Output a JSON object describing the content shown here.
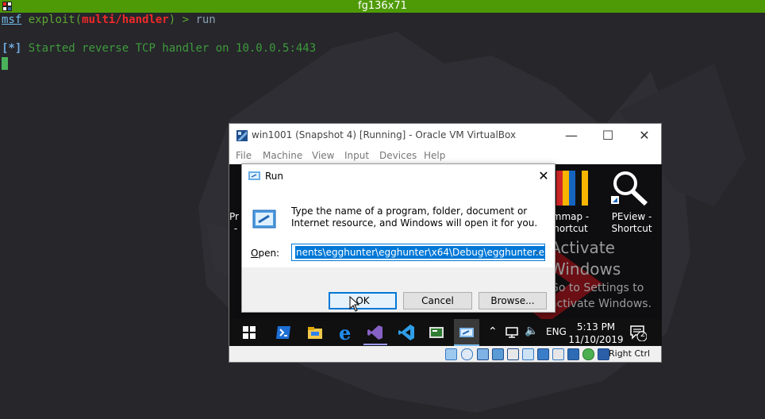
{
  "terminal": {
    "title": "fg136x71",
    "prompt_msf": "msf",
    "prompt_exploit_open": " exploit(",
    "prompt_module": "multi/handler",
    "prompt_exploit_close": ") > ",
    "command": "run",
    "status_bracket": "[*]",
    "status_text": " Started reverse TCP handler on 10.0.0.5:443"
  },
  "vbox": {
    "title": "win1001 (Snapshot 4) [Running] - Oracle VM VirtualBox",
    "menu": [
      "File",
      "Machine",
      "View",
      "Input",
      "Devices",
      "Help"
    ],
    "right_ctrl": "Right Ctrl"
  },
  "guest": {
    "icons": [
      {
        "label_line1": "Pr",
        "label_line2": "-"
      },
      {
        "label_line1": "mmap -",
        "label_line2": "hortcut"
      },
      {
        "label_line1": "PEview -",
        "label_line2": "Shortcut"
      }
    ],
    "activate_title": "Activate Windows",
    "activate_title_line1": "Activate",
    "activate_title_line2": "Windows",
    "activate_sub_line1": "Go to Settings to",
    "activate_sub_line2": "activate Windows.",
    "taskbar": {
      "language": "ENG",
      "time": "5:13 PM",
      "date": "11/10/2019",
      "notifications": "2"
    }
  },
  "run_dialog": {
    "title": "Run",
    "description": "Type the name of a program, folder, document or Internet resource, and Windows will open it for you.",
    "open_label": "Open:",
    "open_value": "nents\\egghunter\\egghunter\\x64\\Debug\\egghunter.exe",
    "ok": "OK",
    "cancel": "Cancel",
    "browse": "Browse..."
  },
  "colors": {
    "terminal_bar": "#4e9a06",
    "accent_blue": "#0078d7"
  }
}
